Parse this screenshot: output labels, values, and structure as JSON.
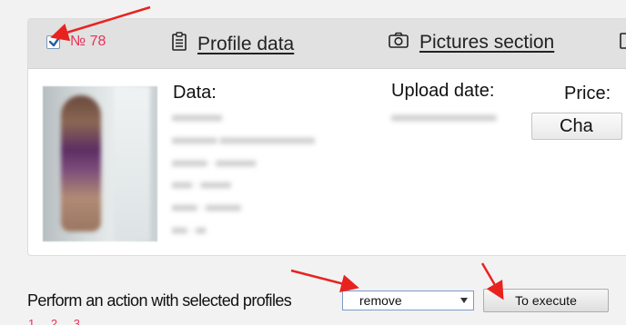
{
  "card": {
    "profile_number": "№ 78",
    "tabs": [
      {
        "label": "Profile data",
        "icon": "clipboard-icon"
      },
      {
        "label": "Pictures section",
        "icon": "camera-icon"
      }
    ],
    "data_title": "Data:",
    "upload_title": "Upload date:",
    "price_title": "Price:",
    "change_button": "Cha"
  },
  "actions": {
    "label": "Perform an action with selected profiles",
    "selected_option": "remove",
    "execute_button": "To execute"
  },
  "pager": [
    "1",
    "2",
    "3"
  ],
  "colors": {
    "accent": "#e8315a",
    "arrow": "#e8231f",
    "header_bg": "#e1e1e1"
  }
}
